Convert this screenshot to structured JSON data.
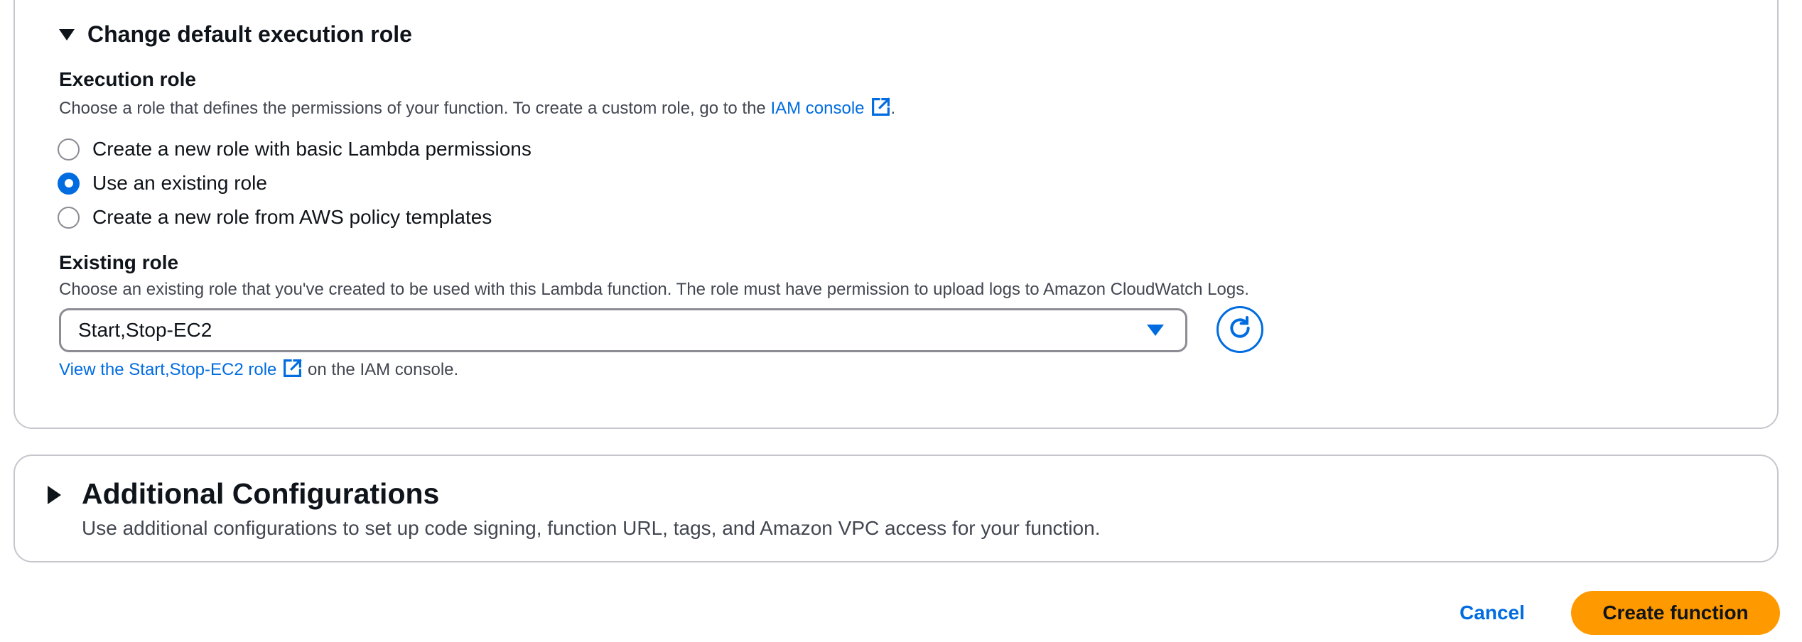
{
  "execution_role_section": {
    "title": "Change default execution role",
    "execution_role": {
      "label": "Execution role",
      "description_prefix": "Choose a role that defines the permissions of your function. To create a custom role, go to the ",
      "description_link": "IAM console",
      "description_suffix": ".",
      "options": [
        {
          "label": "Create a new role with basic Lambda permissions",
          "selected": false
        },
        {
          "label": "Use an existing role",
          "selected": true
        },
        {
          "label": "Create a new role from AWS policy templates",
          "selected": false
        }
      ]
    },
    "existing_role": {
      "label": "Existing role",
      "description": "Choose an existing role that you've created to be used with this Lambda function. The role must have permission to upload logs to Amazon CloudWatch Logs.",
      "selected_value": "Start,Stop-EC2",
      "view_link": "View the Start,Stop-EC2 role",
      "view_suffix": "on the IAM console."
    }
  },
  "additional_configurations": {
    "title": "Additional Configurations",
    "description": "Use additional configurations to set up code signing, function URL, tags, and Amazon VPC access for your function."
  },
  "footer": {
    "cancel_label": "Cancel",
    "create_label": "Create function"
  },
  "colors": {
    "accent": "#006ce0",
    "primary_button": "#ff9900",
    "border": "#c6c6cd",
    "text": "#0f141a",
    "muted_text": "#424650"
  },
  "icons": {
    "expand": "caret-down-icon",
    "collapse": "caret-right-icon",
    "external_link": "external-link-icon",
    "dropdown": "dropdown-caret-icon",
    "refresh": "refresh-icon"
  }
}
